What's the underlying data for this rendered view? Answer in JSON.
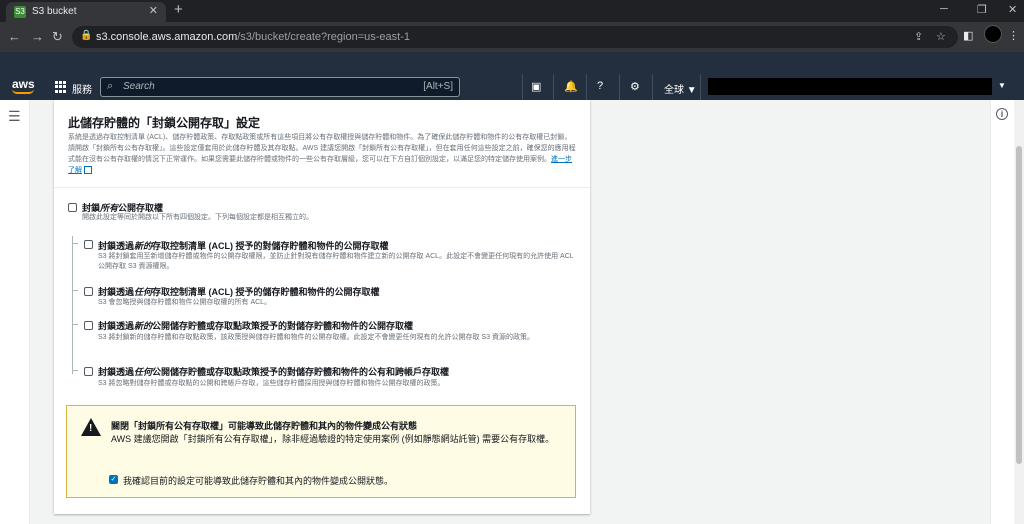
{
  "browser": {
    "tab_title": "S3 bucket",
    "tab_favicon": "S3",
    "close_glyph": "✕",
    "new_tab_glyph": "+",
    "url_host": "s3.console.aws.amazon.com",
    "url_path": "/s3/bucket/create?region=us-east-1"
  },
  "aws_nav": {
    "logo": "aws",
    "services_label": "服務",
    "search_placeholder": "Search",
    "search_shortcut": "[Alt+S]",
    "region_label": "全球 ▼",
    "account_caret": "▼"
  },
  "panel": {
    "title": "此儲存貯體的「封鎖公開存取」設定",
    "description": "系統是透過存取控制清單 (ACL)、儲存貯體政策、存取點政策或所有這些項目將公有存取權授與儲存貯體和物件。為了確保此儲存貯體和物件的公有存取權已封鎖，請開啟「封鎖所有公有存取權」。這些設定僅套用於此儲存貯體及其存取點。AWS 建議您開啟「封鎖所有公有存取權」，但在套用任何這些設定之前，確保您的應用程式能在沒有公有存取權的情況下正常運作。如果您需要此儲存貯體或物件的一些公有存取層級，您可以在下方自訂個別設定，以滿足您的特定儲存使用案例。",
    "learn_more": "進一步了解",
    "block_all": {
      "title_prefix": "封鎖",
      "title_em": "所有",
      "title_suffix": "公開存取權",
      "desc": "開啟此設定等同於開啟以下所有四個設定。下列每個設定都是相互獨立的。"
    },
    "options": [
      {
        "title_prefix": "封鎖透過",
        "title_em": "新的",
        "title_suffix": "存取控制清單 (ACL) 授予的對儲存貯體和物件的公開存取權",
        "desc": "S3 將封鎖套用至新增儲存貯體或物件的公開存取權限，並防止針對現有儲存貯體和物件建立新的公開存取 ACL。此設定不會變更任何現有的允許使用 ACL 公開存取 S3 資源權限。"
      },
      {
        "title_prefix": "封鎖透過",
        "title_em": "任何",
        "title_suffix": "存取控制清單 (ACL) 授予的儲存貯體和物件的公開存取權",
        "desc": "S3 會忽略授與儲存貯體和物件公開存取權的所有 ACL。"
      },
      {
        "title_prefix": "封鎖透過",
        "title_em": "新的",
        "title_suffix": "公開儲存貯體或存取點政策授予的對儲存貯體和物件的公開存取權",
        "desc": "S3 將封鎖新的儲存貯體和存取點政策，該政策授與儲存貯體和物件的公開存取權。此設定不會變更任何現有的允許公開存取 S3 資源的政策。"
      },
      {
        "title_prefix": "封鎖透過",
        "title_em": "任何",
        "title_suffix": "公開儲存貯體或存取點政策授予的對儲存貯體和物件的公有和跨帳戶存取權",
        "desc": "S3 將忽略對儲存貯體或存取點的公開和跨帳戶存取，這些儲存貯體採用授與儲存貯體和物件公開存取權的政策。"
      }
    ]
  },
  "warning": {
    "title": "關閉「封鎖所有公有存取權」可能導致此儲存貯體和其內的物件變成公有狀態",
    "text": "AWS 建議您開啟「封鎖所有公有存取權」，除非經過驗證的特定使用案例 (例如靜態網站託管) 需要公有存取權。",
    "warn_glyph": "!",
    "ack_label": "我確認目前的設定可能導致此儲存貯體和其內的物件變成公開狀態。",
    "ack_checked": true,
    "check_glyph": "✓"
  }
}
